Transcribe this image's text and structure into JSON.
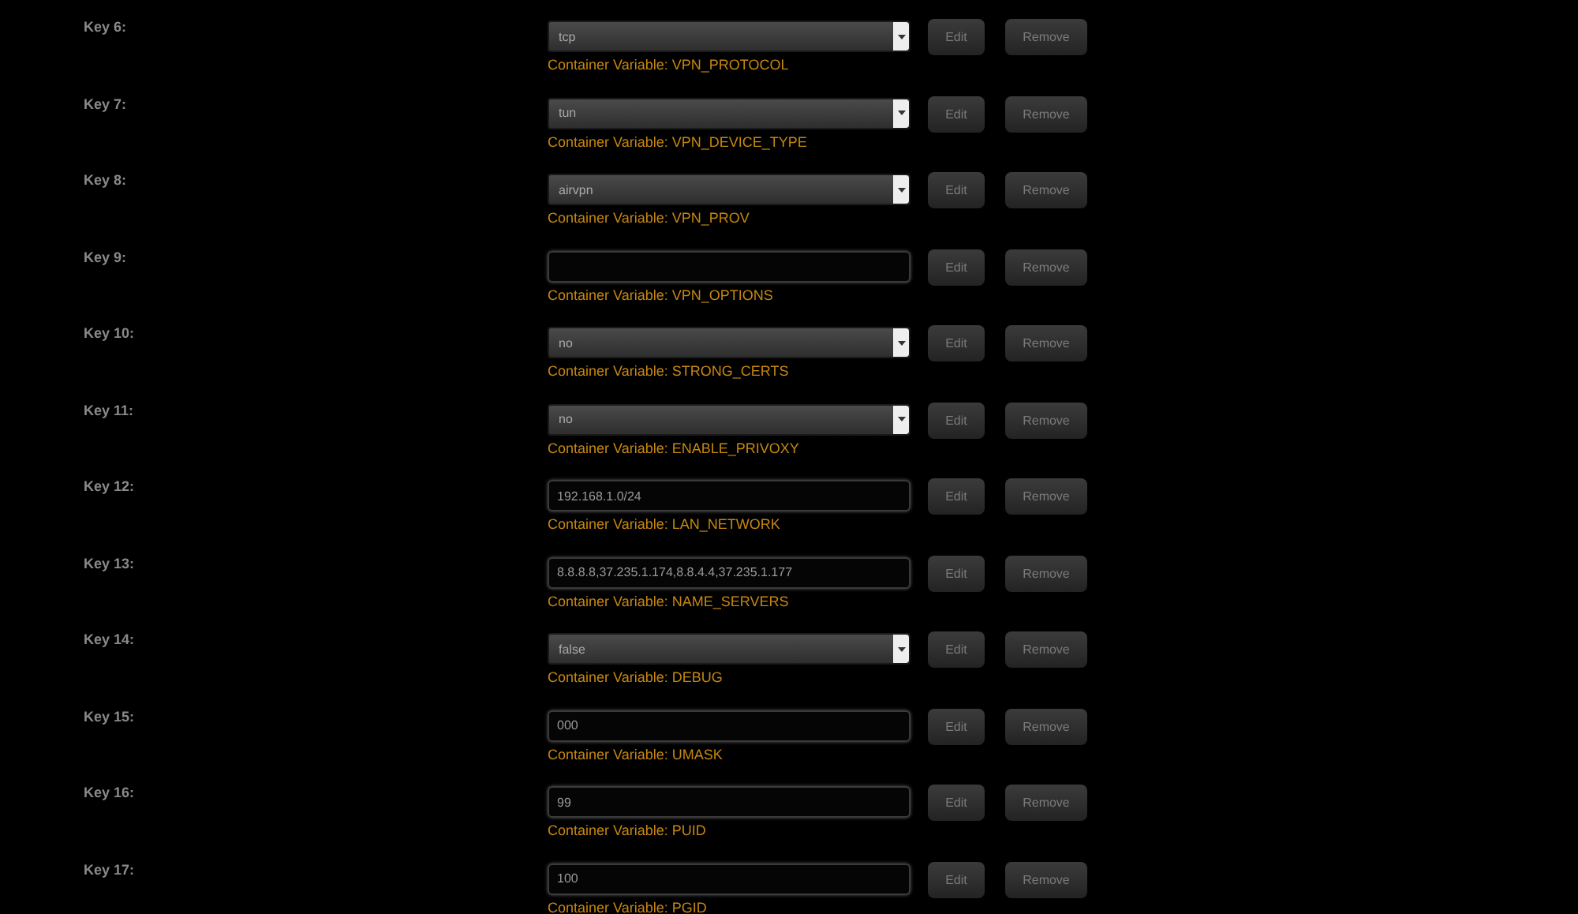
{
  "rows": [
    {
      "label": "Key 6:",
      "kind": "select",
      "value": "tcp",
      "variable": "Container Variable: VPN_PROTOCOL",
      "buttons": [
        "Edit",
        "Remove"
      ]
    },
    {
      "label": "Key 7:",
      "kind": "select",
      "value": "tun",
      "variable": "Container Variable: VPN_DEVICE_TYPE",
      "buttons": [
        "Edit",
        "Remove"
      ]
    },
    {
      "label": "Key 8:",
      "kind": "select",
      "value": "airvpn",
      "variable": "Container Variable: VPN_PROV",
      "buttons": [
        "Edit",
        "Remove"
      ]
    },
    {
      "label": "Key 9:",
      "kind": "text",
      "variable": "Container Variable: VPN_OPTIONS",
      "buttons": [
        "Edit",
        "Remove"
      ]
    },
    {
      "label": "Key 10:",
      "kind": "select",
      "value": "no",
      "variable": "Container Variable: STRONG_CERTS",
      "buttons": [
        "Edit",
        "Remove"
      ]
    },
    {
      "label": "Key 11:",
      "kind": "select",
      "value": "no",
      "variable": "Container Variable: ENABLE_PRIVOXY",
      "buttons": [
        "Edit",
        "Remove"
      ]
    },
    {
      "label": "Key 12:",
      "kind": "text",
      "value": "192.168.1.0/24",
      "variable": "Container Variable: LAN_NETWORK",
      "buttons": [
        "Edit",
        "Remove"
      ]
    },
    {
      "label": "Key 13:",
      "kind": "text",
      "value": "8.8.8.8,37.235.1.174,8.8.4.4,37.235.1.177",
      "variable": "Container Variable: NAME_SERVERS",
      "buttons": [
        "Edit",
        "Remove"
      ]
    },
    {
      "label": "Key 14:",
      "kind": "select",
      "value": "false",
      "variable": "Container Variable: DEBUG",
      "buttons": [
        "Edit",
        "Remove"
      ]
    },
    {
      "label": "Key 15:",
      "kind": "text",
      "value": "000",
      "variable": "Container Variable: UMASK",
      "buttons": [
        "Edit",
        "Remove"
      ]
    },
    {
      "label": "Key 16:",
      "kind": "text",
      "value": "99",
      "variable": "Container Variable: PUID",
      "buttons": [
        "Edit",
        "Remove"
      ]
    },
    {
      "label": "Key 17:",
      "kind": "text",
      "value": "100",
      "variable": "Container Variable: PGID",
      "buttons": [
        "Edit",
        "Remove"
      ]
    }
  ]
}
